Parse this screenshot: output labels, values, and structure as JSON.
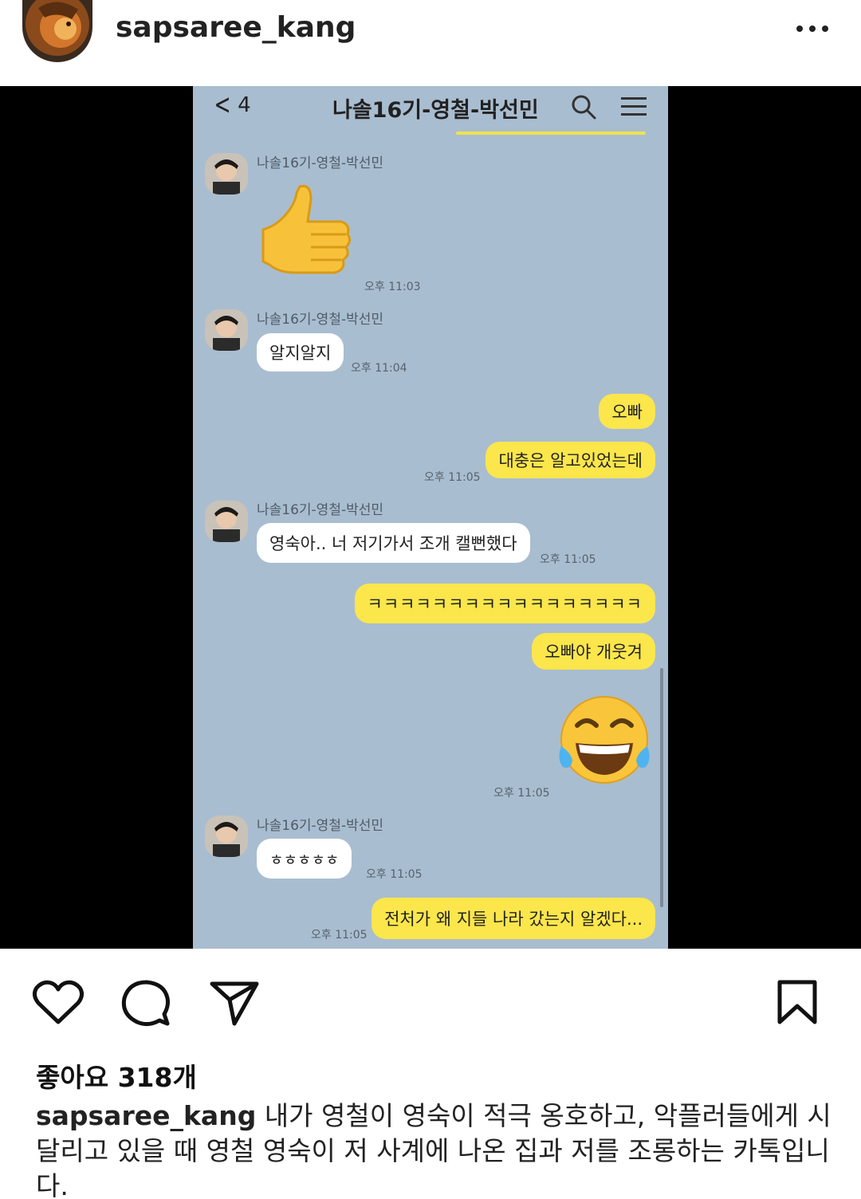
{
  "post": {
    "username": "sapsaree_kang",
    "likes": "좋아요 318개",
    "caption_user": "sapsaree_kang",
    "caption_text": " 내가 영철이 영숙이 적극 옹호하고, 악플러들에게 시달리고 있을 때 영철 영숙이 저 사계에 나온 집과 저를 조롱하는 카톡입니다."
  },
  "chat": {
    "back_count": "4",
    "title": "나솔16기-영철-박선민",
    "messages": [
      {
        "sender": "나솔16기-영철-박선민",
        "time": "오후 11:03"
      },
      {
        "sender": "나솔16기-영철-박선민",
        "text": "알지알지",
        "time": "오후 11:04"
      },
      {
        "text": "오빠"
      },
      {
        "text": "대충은 알고있었는데",
        "time": "오후 11:05"
      },
      {
        "sender": "나솔16기-영철-박선민",
        "text": "영숙아.. 너 저기가서 조개 캘뻔했다",
        "time": "오후 11:05"
      },
      {
        "text": "ㅋㅋㅋㅋㅋㅋㅋㅋㅋㅋㅋㅋㅋㅋㅋㅋㅋ"
      },
      {
        "text": "오빠야 개웃겨"
      },
      {
        "time": "오후 11:05"
      },
      {
        "sender": "나솔16기-영철-박선민",
        "text": "ㅎㅎㅎㅎㅎ",
        "time": "오후 11:05"
      },
      {
        "text": "전처가 왜 지들 나라 갔는지 알겠다...",
        "time": "오후 11:05"
      }
    ]
  },
  "colors": {
    "chat_bg": "#a9bdd0",
    "bubble_out": "#fbe64b",
    "bubble_in": "#ffffff"
  },
  "icons": [
    "heart-icon",
    "comment-icon",
    "share-icon",
    "bookmark-icon",
    "more-icon",
    "search-icon",
    "menu-icon",
    "thumbs-up-emoji",
    "tears-of-joy-emoji"
  ]
}
